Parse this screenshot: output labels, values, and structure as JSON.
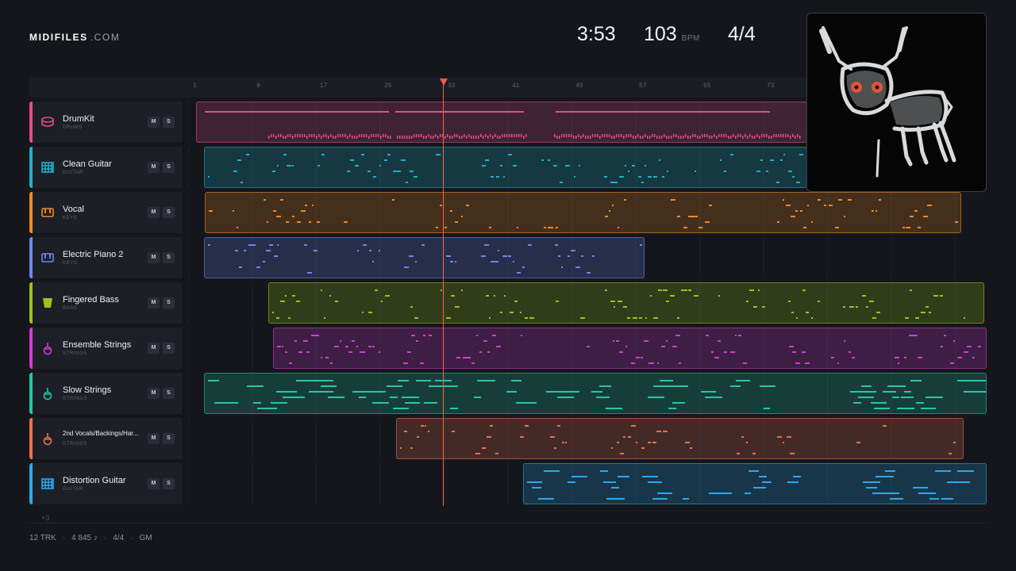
{
  "header": {
    "logo_main": "MIDIFILES",
    "logo_suffix": ".COM",
    "duration": "3:53",
    "tempo": "103",
    "tempo_unit": "BPM",
    "time_signature": "4/4"
  },
  "ruler": {
    "bar_labels": [
      "1",
      "9",
      "17",
      "25",
      "33",
      "41",
      "49",
      "57",
      "65",
      "73"
    ]
  },
  "tracks": [
    {
      "name": "DrumKit",
      "category": "DRUMS",
      "color": "#e0508a",
      "icon": "drum-icon"
    },
    {
      "name": "Clean Guitar",
      "category": "GUITAR",
      "color": "#1fb0c8",
      "icon": "guitar-grid-icon"
    },
    {
      "name": "Vocal",
      "category": "KEYS",
      "color": "#f08a24",
      "icon": "keys-icon"
    },
    {
      "name": "Electric Piano 2",
      "category": "KEYS",
      "color": "#6f86ee",
      "icon": "keys-icon"
    },
    {
      "name": "Fingered Bass",
      "category": "BASS",
      "color": "#9cc21a",
      "icon": "bass-icon"
    },
    {
      "name": "Ensemble Strings",
      "category": "STRINGS",
      "color": "#d43ad8",
      "icon": "violin-icon"
    },
    {
      "name": "Slow Strings",
      "category": "STRINGS",
      "color": "#25c7a4",
      "icon": "violin-icon"
    },
    {
      "name": "2nd Vocals/Backings/Har...",
      "category": "STRINGS",
      "color": "#f0704e",
      "icon": "violin-icon"
    },
    {
      "name": "Distortion Guitar",
      "category": "GUITAR",
      "color": "#2aa8ee",
      "icon": "guitar-grid-icon"
    }
  ],
  "buttons": {
    "mute": "M",
    "solo": "S"
  },
  "hidden_tracks": "+3",
  "footer": {
    "tracks": "12 TRK",
    "notes": "4 845 ♪",
    "signature": "4/4",
    "standard": "GM"
  },
  "colors": {
    "background": "#14161b",
    "playhead": "#ff5a4a"
  }
}
